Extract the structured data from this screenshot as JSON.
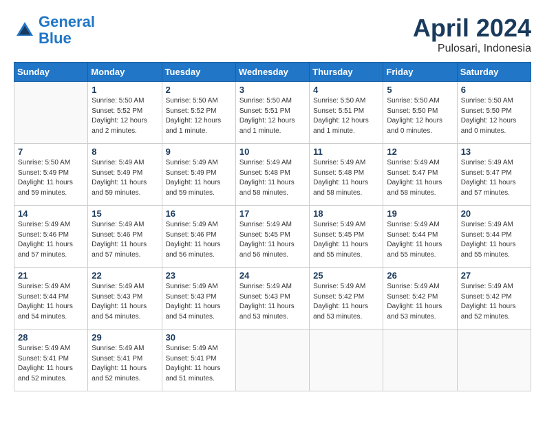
{
  "header": {
    "logo_line1": "General",
    "logo_line2": "Blue",
    "title": "April 2024",
    "subtitle": "Pulosari, Indonesia"
  },
  "days_of_week": [
    "Sunday",
    "Monday",
    "Tuesday",
    "Wednesday",
    "Thursday",
    "Friday",
    "Saturday"
  ],
  "weeks": [
    [
      {
        "num": "",
        "info": ""
      },
      {
        "num": "1",
        "info": "Sunrise: 5:50 AM\nSunset: 5:52 PM\nDaylight: 12 hours\nand 2 minutes."
      },
      {
        "num": "2",
        "info": "Sunrise: 5:50 AM\nSunset: 5:52 PM\nDaylight: 12 hours\nand 1 minute."
      },
      {
        "num": "3",
        "info": "Sunrise: 5:50 AM\nSunset: 5:51 PM\nDaylight: 12 hours\nand 1 minute."
      },
      {
        "num": "4",
        "info": "Sunrise: 5:50 AM\nSunset: 5:51 PM\nDaylight: 12 hours\nand 1 minute."
      },
      {
        "num": "5",
        "info": "Sunrise: 5:50 AM\nSunset: 5:50 PM\nDaylight: 12 hours\nand 0 minutes."
      },
      {
        "num": "6",
        "info": "Sunrise: 5:50 AM\nSunset: 5:50 PM\nDaylight: 12 hours\nand 0 minutes."
      }
    ],
    [
      {
        "num": "7",
        "info": "Sunrise: 5:50 AM\nSunset: 5:49 PM\nDaylight: 11 hours\nand 59 minutes."
      },
      {
        "num": "8",
        "info": "Sunrise: 5:49 AM\nSunset: 5:49 PM\nDaylight: 11 hours\nand 59 minutes."
      },
      {
        "num": "9",
        "info": "Sunrise: 5:49 AM\nSunset: 5:49 PM\nDaylight: 11 hours\nand 59 minutes."
      },
      {
        "num": "10",
        "info": "Sunrise: 5:49 AM\nSunset: 5:48 PM\nDaylight: 11 hours\nand 58 minutes."
      },
      {
        "num": "11",
        "info": "Sunrise: 5:49 AM\nSunset: 5:48 PM\nDaylight: 11 hours\nand 58 minutes."
      },
      {
        "num": "12",
        "info": "Sunrise: 5:49 AM\nSunset: 5:47 PM\nDaylight: 11 hours\nand 58 minutes."
      },
      {
        "num": "13",
        "info": "Sunrise: 5:49 AM\nSunset: 5:47 PM\nDaylight: 11 hours\nand 57 minutes."
      }
    ],
    [
      {
        "num": "14",
        "info": "Sunrise: 5:49 AM\nSunset: 5:46 PM\nDaylight: 11 hours\nand 57 minutes."
      },
      {
        "num": "15",
        "info": "Sunrise: 5:49 AM\nSunset: 5:46 PM\nDaylight: 11 hours\nand 57 minutes."
      },
      {
        "num": "16",
        "info": "Sunrise: 5:49 AM\nSunset: 5:46 PM\nDaylight: 11 hours\nand 56 minutes."
      },
      {
        "num": "17",
        "info": "Sunrise: 5:49 AM\nSunset: 5:45 PM\nDaylight: 11 hours\nand 56 minutes."
      },
      {
        "num": "18",
        "info": "Sunrise: 5:49 AM\nSunset: 5:45 PM\nDaylight: 11 hours\nand 55 minutes."
      },
      {
        "num": "19",
        "info": "Sunrise: 5:49 AM\nSunset: 5:44 PM\nDaylight: 11 hours\nand 55 minutes."
      },
      {
        "num": "20",
        "info": "Sunrise: 5:49 AM\nSunset: 5:44 PM\nDaylight: 11 hours\nand 55 minutes."
      }
    ],
    [
      {
        "num": "21",
        "info": "Sunrise: 5:49 AM\nSunset: 5:44 PM\nDaylight: 11 hours\nand 54 minutes."
      },
      {
        "num": "22",
        "info": "Sunrise: 5:49 AM\nSunset: 5:43 PM\nDaylight: 11 hours\nand 54 minutes."
      },
      {
        "num": "23",
        "info": "Sunrise: 5:49 AM\nSunset: 5:43 PM\nDaylight: 11 hours\nand 54 minutes."
      },
      {
        "num": "24",
        "info": "Sunrise: 5:49 AM\nSunset: 5:43 PM\nDaylight: 11 hours\nand 53 minutes."
      },
      {
        "num": "25",
        "info": "Sunrise: 5:49 AM\nSunset: 5:42 PM\nDaylight: 11 hours\nand 53 minutes."
      },
      {
        "num": "26",
        "info": "Sunrise: 5:49 AM\nSunset: 5:42 PM\nDaylight: 11 hours\nand 53 minutes."
      },
      {
        "num": "27",
        "info": "Sunrise: 5:49 AM\nSunset: 5:42 PM\nDaylight: 11 hours\nand 52 minutes."
      }
    ],
    [
      {
        "num": "28",
        "info": "Sunrise: 5:49 AM\nSunset: 5:41 PM\nDaylight: 11 hours\nand 52 minutes."
      },
      {
        "num": "29",
        "info": "Sunrise: 5:49 AM\nSunset: 5:41 PM\nDaylight: 11 hours\nand 52 minutes."
      },
      {
        "num": "30",
        "info": "Sunrise: 5:49 AM\nSunset: 5:41 PM\nDaylight: 11 hours\nand 51 minutes."
      },
      {
        "num": "",
        "info": ""
      },
      {
        "num": "",
        "info": ""
      },
      {
        "num": "",
        "info": ""
      },
      {
        "num": "",
        "info": ""
      }
    ]
  ]
}
